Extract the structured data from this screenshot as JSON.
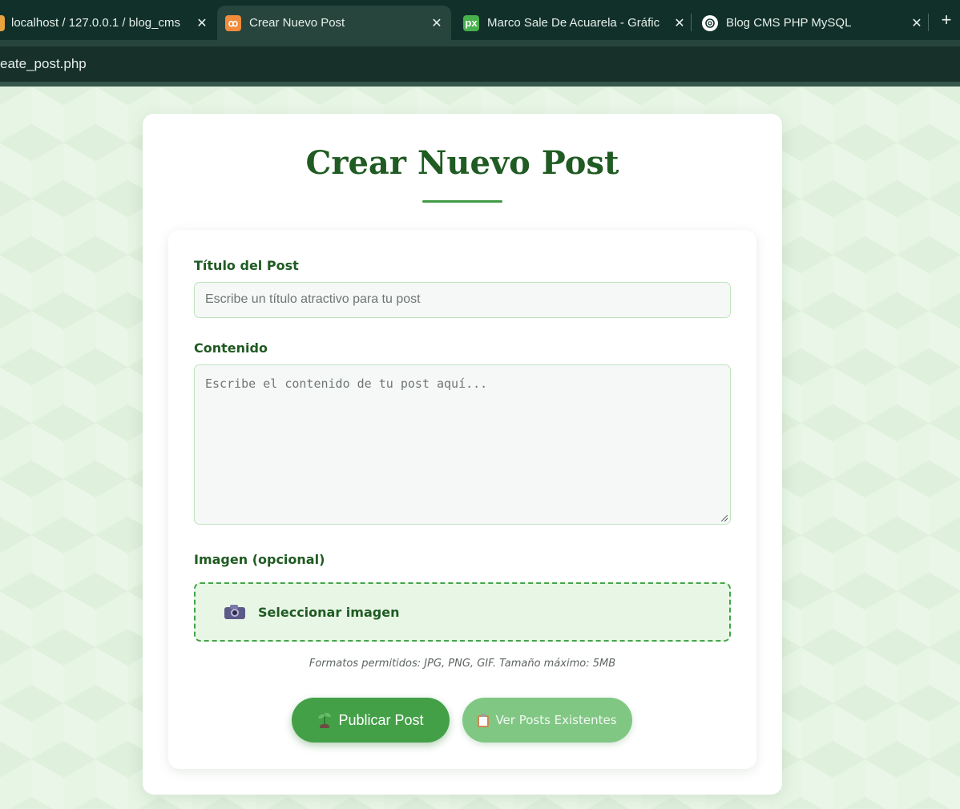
{
  "browser": {
    "tabs": [
      {
        "label": "localhost / 127.0.0.1 / blog_cms",
        "favicon": "phpmyadmin-icon",
        "active": false
      },
      {
        "label": "Crear Nuevo Post",
        "favicon": "xampp-icon",
        "active": true
      },
      {
        "label": "Marco Sale De Acuarela - Gráfic",
        "favicon": "pixabay-icon",
        "active": false
      },
      {
        "label": "Blog CMS PHP MySQL",
        "favicon": "openai-icon",
        "active": false
      }
    ],
    "favicon_text": {
      "xampp": "ꝏ",
      "pixabay": "px"
    },
    "close_glyph": "✕",
    "new_tab_glyph": "+",
    "url": "eate_post.php"
  },
  "page": {
    "title": "Crear Nuevo Post",
    "form": {
      "title_label": "Título del Post",
      "title_placeholder": "Escribe un título atractivo para tu post",
      "content_label": "Contenido",
      "content_placeholder": "Escribe el contenido de tu post aquí...",
      "image_label": "Imagen (opcional)",
      "upload_label": "Seleccionar imagen",
      "upload_icon": "camera-icon",
      "hint": "Formatos permitidos: JPG, PNG, GIF. Tamaño máximo: 5MB",
      "submit_label": "Publicar Post",
      "submit_icon": "sprout-icon",
      "view_posts_label": "Ver Posts Existentes",
      "view_posts_icon": "clipboard-icon"
    }
  },
  "colors": {
    "primary": "#43a047",
    "primary_light": "#81c784",
    "title_green": "#1f5b22",
    "chrome_dark": "#12302a"
  }
}
